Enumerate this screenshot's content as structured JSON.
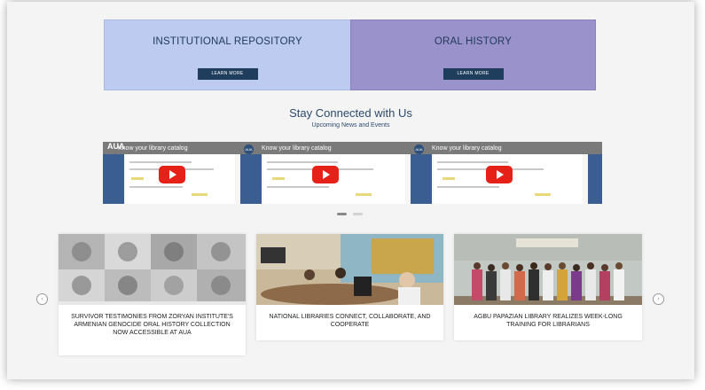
{
  "promos": [
    {
      "title": "INSTITUTIONAL REPOSITORY",
      "button": "LEARN MORE"
    },
    {
      "title": "ORAL HISTORY",
      "button": "LEARN MORE"
    }
  ],
  "stay": {
    "title": "Stay Connected with Us",
    "subtitle": "Upcoming News and Events"
  },
  "videos": [
    {
      "channel": "AUA",
      "title": "Know your library catalog"
    },
    {
      "channel": "AUA",
      "title": "Know your library catalog"
    },
    {
      "channel": "AUA",
      "title": "Know your library catalog"
    }
  ],
  "news": [
    {
      "title": "SURVIVOR TESTIMONIES FROM ZORYAN INSTITUTE'S ARMENIAN GENOCIDE ORAL HISTORY COLLECTION NOW ACCESSIBLE AT AUA"
    },
    {
      "title": "NATIONAL LIBRARIES CONNECT, COLLABORATE, AND COOPERATE"
    },
    {
      "title": "AGBU PAPAZIAN LIBRARY REALIZES WEEK-LONG TRAINING FOR LIBRARIANS"
    }
  ],
  "carousel": {
    "prev_icon": "chevron-left-icon",
    "next_icon": "chevron-right-icon"
  },
  "colors": {
    "ir_bg": "#bccbef",
    "oh_bg": "#9a92cb",
    "button_bg": "#1f3e5e",
    "heading": "#2c4a6c",
    "play": "#e62117"
  }
}
